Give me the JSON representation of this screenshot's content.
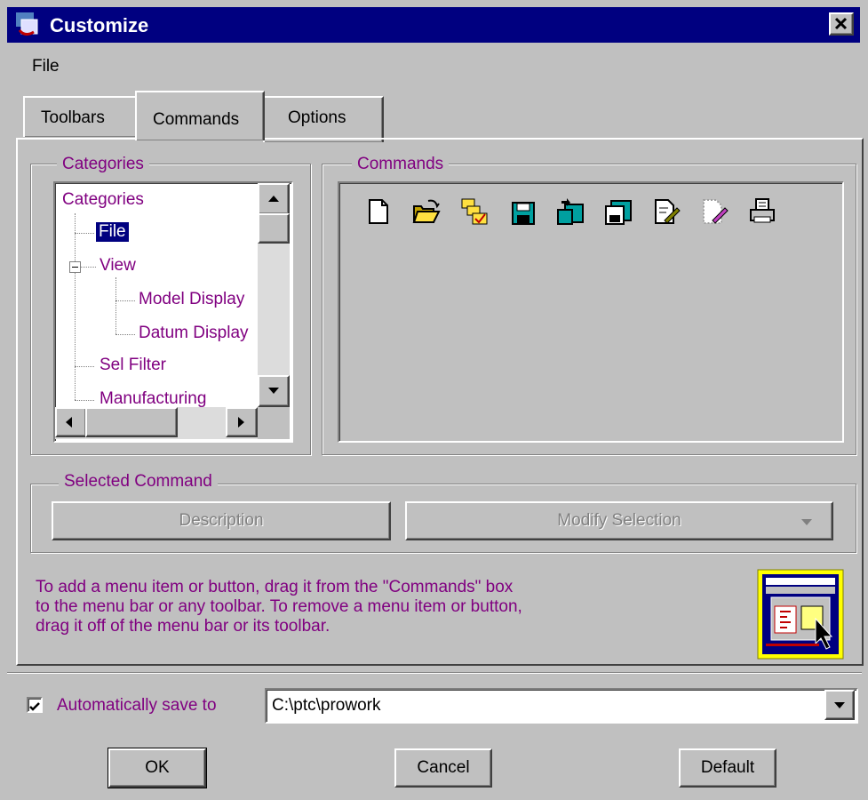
{
  "window": {
    "title": "Customize"
  },
  "menu": {
    "file": "File"
  },
  "tabs": [
    {
      "label": "Toolbars"
    },
    {
      "label": "Commands"
    },
    {
      "label": "Options"
    }
  ],
  "categories": {
    "group_label": "Categories",
    "tree": [
      {
        "label": "Categories",
        "selected": false
      },
      {
        "label": "File",
        "selected": true
      },
      {
        "label": "View",
        "selected": false
      },
      {
        "label": "Model Display",
        "selected": false
      },
      {
        "label": "Datum Display",
        "selected": false
      },
      {
        "label": "Sel Filter",
        "selected": false
      },
      {
        "label": "Manufacturing",
        "selected": false
      }
    ]
  },
  "commands": {
    "group_label": "Commands",
    "icons": [
      "new-file-icon",
      "open-file-icon",
      "select-working-directory-icon",
      "save-icon",
      "save-a-copy-icon",
      "backup-icon",
      "rename-icon",
      "erase-icon",
      "print-icon"
    ]
  },
  "selected_command": {
    "group_label": "Selected Command",
    "description_label": "Description",
    "modify_label": "Modify Selection"
  },
  "help_text": {
    "line1": "To add a menu item or button, drag it from the \"Commands\" box",
    "line2": "to the menu bar or any toolbar.  To remove a menu item or button,",
    "line3": "drag it off of the menu bar or its toolbar."
  },
  "autosave": {
    "label": "Automatically save to",
    "checked": true,
    "path": "C:\\ptc\\prowork"
  },
  "buttons": {
    "ok": "OK",
    "cancel": "Cancel",
    "default": "Default"
  },
  "colors": {
    "titlebar": "#000080",
    "selected": "#000080",
    "label": "#800080",
    "face": "#c0c0c0"
  }
}
